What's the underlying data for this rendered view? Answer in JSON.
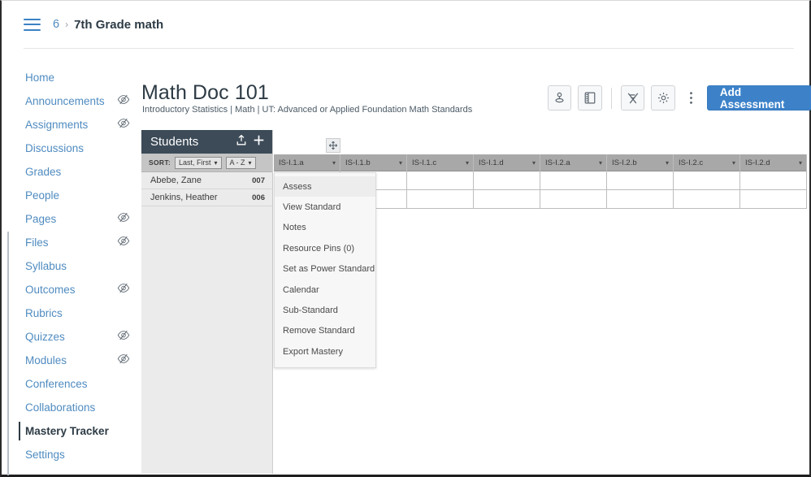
{
  "breadcrumb": {
    "menu_icon": "hamburger-icon",
    "course_number": "6",
    "separator": "›",
    "current": "7th Grade math"
  },
  "sidebar": {
    "items": [
      {
        "label": "Home",
        "hidden_icon": false
      },
      {
        "label": "Announcements",
        "hidden_icon": true
      },
      {
        "label": "Assignments",
        "hidden_icon": true
      },
      {
        "label": "Discussions",
        "hidden_icon": false
      },
      {
        "label": "Grades",
        "hidden_icon": false
      },
      {
        "label": "People",
        "hidden_icon": false
      },
      {
        "label": "Pages",
        "hidden_icon": true
      },
      {
        "label": "Files",
        "hidden_icon": true
      },
      {
        "label": "Syllabus",
        "hidden_icon": false
      },
      {
        "label": "Outcomes",
        "hidden_icon": true
      },
      {
        "label": "Rubrics",
        "hidden_icon": false
      },
      {
        "label": "Quizzes",
        "hidden_icon": true
      },
      {
        "label": "Modules",
        "hidden_icon": true
      },
      {
        "label": "Conferences",
        "hidden_icon": false
      },
      {
        "label": "Collaborations",
        "hidden_icon": false
      },
      {
        "label": "Mastery Tracker",
        "hidden_icon": false,
        "active": true
      },
      {
        "label": "Settings",
        "hidden_icon": false
      }
    ]
  },
  "header": {
    "title": "Math Doc 101",
    "subtitle": "Introductory Statistics  |  Math  |  UT: Advanced or Applied Foundation Math Standards",
    "toolbar": {
      "buttons": [
        {
          "name": "student-profile-icon",
          "glyph": "person"
        },
        {
          "name": "notebook-panel-icon",
          "glyph": "notebook"
        },
        {
          "name": "design-tools-icon",
          "glyph": "pencil-ruler"
        },
        {
          "name": "settings-gear-icon",
          "glyph": "gear"
        },
        {
          "name": "more-options-icon",
          "glyph": "kebab"
        }
      ],
      "add_assessment_label": "Add Assessment",
      "accent_color": "#3d82c9"
    }
  },
  "students_panel": {
    "title": "Students",
    "share_icon": "upload-share-icon",
    "add_icon": "plus-icon",
    "sort_label": "SORT:",
    "sort_field": "Last, First",
    "sort_order": "A - Z",
    "rows": [
      {
        "name": "Abebe, Zane",
        "id": "007"
      },
      {
        "name": "Jenkins, Heather",
        "id": "006"
      }
    ],
    "header_color": "#3d4b58"
  },
  "grid": {
    "drag_handle_icon": "move-handle-icon",
    "columns": [
      "IS-I.1.a",
      "IS-I.1.b",
      "IS-I.1.c",
      "IS-I.1.d",
      "IS-I.2.a",
      "IS-I.2.b",
      "IS-I.2.c",
      "IS-I.2.d"
    ],
    "caret": "▾",
    "row_count": 2
  },
  "context_menu": {
    "items": [
      {
        "label": "Assess",
        "highlighted": true
      },
      {
        "label": "View Standard",
        "highlighted": false
      },
      {
        "label": "Notes",
        "highlighted": false
      },
      {
        "label": "Resource Pins (0)",
        "highlighted": false
      },
      {
        "label": "Set as Power Standard",
        "highlighted": false
      },
      {
        "label": "Calendar",
        "highlighted": false
      },
      {
        "label": "Sub-Standard",
        "highlighted": false
      },
      {
        "label": "Remove Standard",
        "highlighted": false
      },
      {
        "label": "Export Mastery",
        "highlighted": false
      }
    ]
  }
}
